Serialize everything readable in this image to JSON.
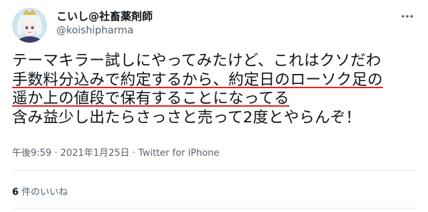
{
  "author": {
    "display_name": "こいし@社畜薬剤師",
    "handle": "@koishipharma"
  },
  "tweet": {
    "line1": "テーマキラー試しにやってみたけど、これはクソだわ",
    "line2": "手数料分込みで約定するから、約定日のローソク足の",
    "line3": "遥か上の値段で保有することになってる",
    "line4": "含み益少し出たらさっさと売って2度とやらんぞ！"
  },
  "meta": {
    "time": "午後9:59",
    "separator1": " · ",
    "date": "2021年1月25日",
    "separator2": " · ",
    "source": "Twitter for iPhone"
  },
  "likes": {
    "count": "6",
    "label": " 件のいいね"
  },
  "colors": {
    "highlight_underline": "#e8251f",
    "secondary_text": "#536471",
    "primary_text": "#0f1419"
  },
  "icons": {
    "more": "more-options-icon",
    "avatar": "avatar"
  }
}
